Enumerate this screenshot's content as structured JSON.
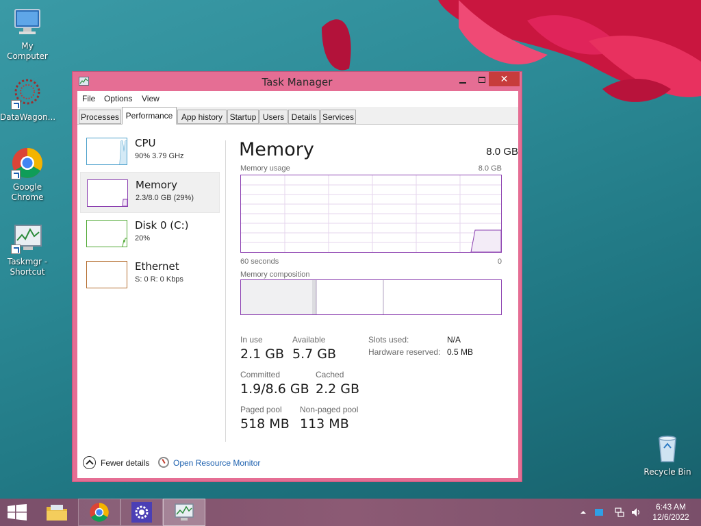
{
  "desktop": {
    "icons": [
      {
        "name": "my-computer",
        "label": "My Computer"
      },
      {
        "name": "datawagon",
        "label": "DataWagon..."
      },
      {
        "name": "google-chrome",
        "label": "Google Chrome"
      },
      {
        "name": "taskmgr-shortcut",
        "label": "Taskmgr - Shortcut"
      },
      {
        "name": "recycle-bin",
        "label": "Recycle Bin"
      }
    ]
  },
  "window": {
    "title": "Task Manager",
    "close_glyph": "✕",
    "menu": [
      "File",
      "Options",
      "View"
    ],
    "tabs": [
      "Processes",
      "Performance",
      "App history",
      "Startup",
      "Users",
      "Details",
      "Services"
    ],
    "active_tab": "Performance"
  },
  "sidebar": [
    {
      "name": "CPU",
      "sub": "90%  3.79 GHz",
      "color": "#4a9fcb",
      "selected": false
    },
    {
      "name": "Memory",
      "sub": "2.3/8.0 GB (29%)",
      "color": "#8b3fb0",
      "selected": true
    },
    {
      "name": "Disk 0 (C:)",
      "sub": "20%",
      "color": "#4ea832",
      "selected": false
    },
    {
      "name": "Ethernet",
      "sub": "S: 0  R: 0 Kbps",
      "color": "#b36b2c",
      "selected": false
    }
  ],
  "memory": {
    "title": "Memory",
    "total": "8.0 GB",
    "usage_label": "Memory usage",
    "usage_max": "8.0 GB",
    "axis_left": "60 seconds",
    "axis_right": "0",
    "composition_label": "Memory composition",
    "stats": {
      "in_use_label": "In use",
      "in_use": "2.1 GB",
      "available_label": "Available",
      "available": "5.7 GB",
      "committed_label": "Committed",
      "committed": "1.9/8.6 GB",
      "cached_label": "Cached",
      "cached": "2.2 GB",
      "paged_label": "Paged pool",
      "paged": "518 MB",
      "nonpaged_label": "Non-paged pool",
      "nonpaged": "113 MB"
    },
    "kv": {
      "slots_label": "Slots used:",
      "slots": "N/A",
      "hw_label": "Hardware reserved:",
      "hw": "0.5 MB"
    }
  },
  "footer": {
    "fewer_details": "Fewer details",
    "resource_monitor": "Open Resource Monitor"
  },
  "taskbar": {
    "time": "6:43 AM",
    "date": "12/6/2022"
  },
  "colors": {
    "memory_accent": "#8b3fb0",
    "window_frame": "#e56e94",
    "close_button": "#c73c3c"
  }
}
